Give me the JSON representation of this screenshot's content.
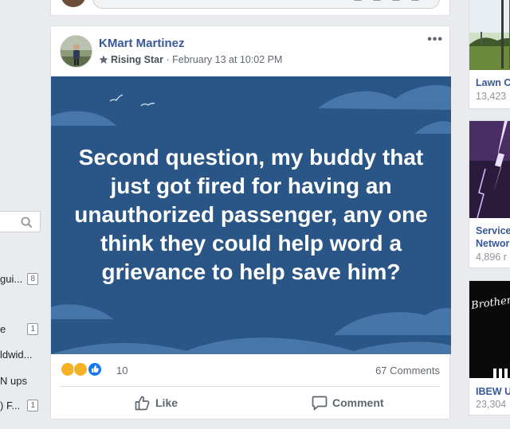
{
  "left_sidebar": {
    "items": [
      {
        "label": "gui...",
        "count": "8"
      },
      {
        "label": "e",
        "count": "1"
      },
      {
        "label": "ldwid...",
        "count": ""
      },
      {
        "label": "N ups",
        "count": ""
      },
      {
        "label": ") F...",
        "count": "1"
      }
    ]
  },
  "post": {
    "author": "KMart Martinez",
    "badge": "Rising Star",
    "separator": "·",
    "timestamp": "February 13 at 10:02 PM",
    "text": "Second question, my buddy that just got fired for having an unauthorized passenger, any one think they could help word a grievance to help save him?",
    "background_color": "#2a5687",
    "reaction_icons": [
      "haha-icon",
      "wow-icon",
      "like-icon"
    ],
    "reaction_count": "10",
    "comments_count": "67 Comments",
    "like_label": "Like",
    "comment_label": "Comment"
  },
  "right_column": [
    {
      "name": "Lawn C",
      "sub": "13,423"
    },
    {
      "name": "Service",
      "name2": "Networ",
      "sub": "4,896 r"
    },
    {
      "name": "IBEW U",
      "sub": "23,304",
      "image_text": "Brothers"
    }
  ]
}
